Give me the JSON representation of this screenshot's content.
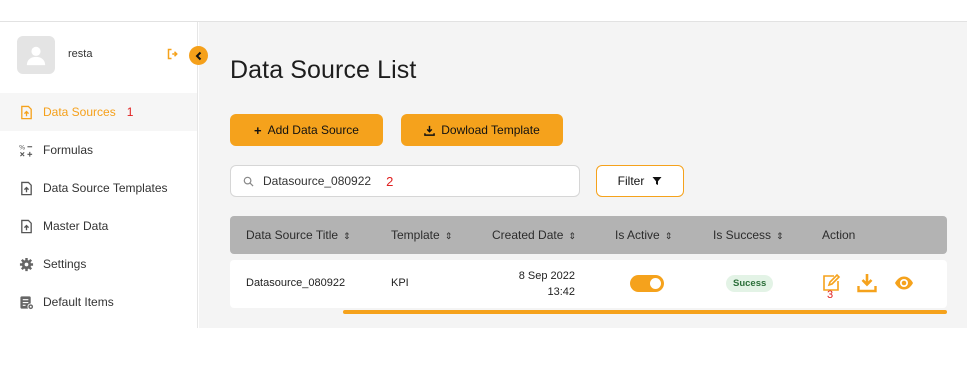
{
  "user": {
    "name": "resta"
  },
  "sidebar": {
    "items": [
      {
        "label": "Data Sources",
        "icon": "upload-file-icon",
        "active": true,
        "marker": "1"
      },
      {
        "label": "Formulas",
        "icon": "formula-icon"
      },
      {
        "label": "Data Source Templates",
        "icon": "upload-file-icon"
      },
      {
        "label": "Master Data",
        "icon": "upload-file-icon"
      },
      {
        "label": "Settings",
        "icon": "gear-icon"
      },
      {
        "label": "Default Items",
        "icon": "list-settings-icon"
      }
    ]
  },
  "main": {
    "title": "Data Source List",
    "add_button": "Add Data Source",
    "template_button": "Dowload Template",
    "search": {
      "value": "Datasource_080922",
      "marker": "2"
    },
    "filter_button": "Filter",
    "table": {
      "columns": [
        "Data Source Title",
        "Template",
        "Created Date",
        "Is Active",
        "Is Success",
        "Action"
      ],
      "sort_glyph": "⇕",
      "rows": [
        {
          "title": "Datasource_080922",
          "template": "KPI",
          "created_date": "8 Sep 2022",
          "created_time": "13:42",
          "is_active": true,
          "is_success": "Sucess",
          "action_marker": "3"
        }
      ]
    }
  },
  "colors": {
    "accent": "#f5a21c",
    "marker": "#e02020",
    "success_bg": "#e3f3e6"
  }
}
